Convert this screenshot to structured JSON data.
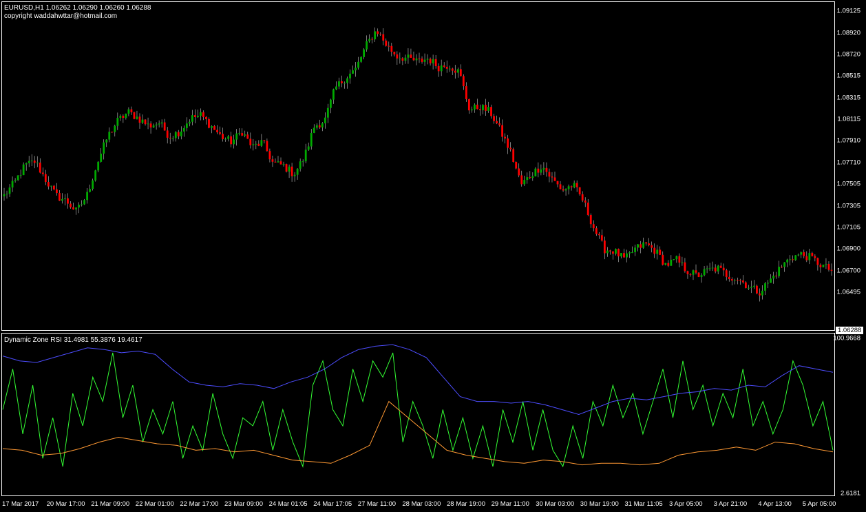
{
  "window": {
    "symbol_line": "EURUSD,H1  1.06262 1.06290 1.06260 1.06288",
    "copyright": "copyright waddahwttar@hotmail.com",
    "current_price": "1.06288"
  },
  "indicator": {
    "title": "Dynamic Zone RSI 31.4981 55.3876 19.4617",
    "scale_max": "100.9668",
    "scale_min": "2.6181"
  },
  "colors": {
    "background": "#000000",
    "bull_candle": "#00aa00",
    "bear_candle": "#ff0000",
    "frame": "#ffffff",
    "rsi_line": "#33ff33",
    "upper_zone": "#4d4dff",
    "lower_zone": "#ff9933"
  },
  "chart_data": [
    {
      "type": "candlestick",
      "title": "EURUSD,H1",
      "ylim": [
        1.0615,
        1.092
      ],
      "y_ticks": [
        "1.09125",
        "1.08920",
        "1.08720",
        "1.08515",
        "1.08315",
        "1.08115",
        "1.07910",
        "1.07710",
        "1.07505",
        "1.07305",
        "1.07105",
        "1.06900",
        "1.06700",
        "1.06495"
      ],
      "x_ticks": [
        "17 Mar 2017",
        "20 Mar 17:00",
        "21 Mar 09:00",
        "22 Mar 01:00",
        "22 Mar 17:00",
        "23 Mar 09:00",
        "24 Mar 01:05",
        "24 Mar 17:05",
        "27 Mar 11:00",
        "28 Mar 03:00",
        "28 Mar 19:00",
        "29 Mar 11:00",
        "30 Mar 03:00",
        "30 Mar 19:00",
        "31 Mar 11:05",
        "3 Apr 05:00",
        "3 Apr 21:00",
        "4 Apr 13:00",
        "5 Apr 05:00"
      ],
      "close_path": [
        1.074,
        1.0752,
        1.0768,
        1.0772,
        1.0755,
        1.074,
        1.0735,
        1.0725,
        1.074,
        1.077,
        1.0795,
        1.081,
        1.0818,
        1.0812,
        1.0805,
        1.0808,
        1.0795,
        1.08,
        1.0812,
        1.0815,
        1.0805,
        1.0795,
        1.079,
        1.08,
        1.0785,
        1.079,
        1.077,
        1.0768,
        1.076,
        1.0775,
        1.0805,
        1.081,
        1.084,
        1.085,
        1.0858,
        1.088,
        1.0895,
        1.088,
        1.087,
        1.0868,
        1.0865,
        1.0868,
        1.086,
        1.0862,
        1.0855,
        1.082,
        1.0823,
        1.0818,
        1.08,
        1.078,
        1.075,
        1.076,
        1.0768,
        1.0755,
        1.0745,
        1.075,
        1.0735,
        1.071,
        1.069,
        1.0688,
        1.068,
        1.069,
        1.0695,
        1.0688,
        1.0675,
        1.068,
        1.067,
        1.0665,
        1.067,
        1.0672,
        1.0665,
        1.0662,
        1.0655,
        1.065,
        1.066,
        1.0672,
        1.0682,
        1.0685,
        1.0682,
        1.0675,
        1.067
      ]
    },
    {
      "type": "line",
      "title": "Dynamic Zone RSI",
      "ylim": [
        2.6181,
        100.9668
      ],
      "series": [
        {
          "name": "31.4981",
          "color": "#33ff33",
          "values": [
            55,
            80,
            40,
            70,
            25,
            50,
            20,
            65,
            45,
            75,
            60,
            90,
            50,
            70,
            35,
            55,
            40,
            60,
            25,
            45,
            30,
            65,
            40,
            25,
            50,
            45,
            60,
            30,
            55,
            35,
            20,
            70,
            85,
            55,
            45,
            80,
            60,
            85,
            75,
            90,
            35,
            60,
            45,
            25,
            55,
            30,
            50,
            25,
            45,
            20,
            55,
            35,
            60,
            30,
            55,
            30,
            20,
            45,
            25,
            60,
            45,
            70,
            50,
            65,
            40,
            60,
            80,
            50,
            85,
            55,
            70,
            45,
            65,
            50,
            80,
            45,
            60,
            40,
            55,
            85,
            70,
            45,
            60,
            30
          ]
        },
        {
          "name": "55.3876",
          "color": "#4d4dff",
          "values": [
            88,
            85,
            84,
            87,
            90,
            93,
            92,
            90,
            91,
            89,
            80,
            72,
            70,
            69,
            71,
            70,
            68,
            72,
            75,
            80,
            87,
            92,
            94,
            95,
            92,
            87,
            75,
            63,
            60,
            60,
            59,
            60,
            58,
            55,
            52,
            56,
            60,
            62,
            61,
            63,
            65,
            66,
            68,
            67,
            70,
            69,
            76,
            82,
            80,
            78
          ]
        },
        {
          "name": "19.4617",
          "color": "#ff9933",
          "values": [
            31,
            30,
            27,
            28,
            31,
            35,
            38,
            36,
            34,
            33,
            30,
            31,
            29,
            30,
            27,
            24,
            23,
            22,
            27,
            33,
            60,
            50,
            40,
            30,
            27,
            25,
            23,
            22,
            24,
            23,
            21,
            22,
            22,
            21,
            22,
            27,
            29,
            30,
            32,
            30,
            35,
            34,
            31,
            29
          ]
        }
      ]
    }
  ]
}
